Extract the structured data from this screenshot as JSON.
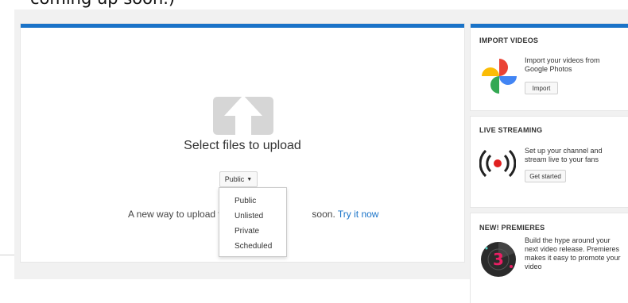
{
  "caption": "coming up soon.)",
  "upload": {
    "select_files": "Select files to upload",
    "privacy_value": "Public",
    "new_way_prefix": "A new way to upload v",
    "new_way_suffix": "soon. ",
    "try_it": "Try it now",
    "options": [
      "Public",
      "Unlisted",
      "Private",
      "Scheduled"
    ]
  },
  "sidebar": {
    "import": {
      "title": "IMPORT VIDEOS",
      "text": "Import your videos from Google Photos",
      "button": "Import"
    },
    "live": {
      "title": "LIVE STREAMING",
      "text": "Set up your channel and stream live to your fans",
      "button": "Get started"
    },
    "premieres": {
      "title": "NEW! PREMIERES",
      "text": "Build the hype around your next video release. Premieres makes it easy to promote your video",
      "badge": "3"
    }
  },
  "colors": {
    "accent": "#1a73c8",
    "live_red": "#e02020"
  }
}
